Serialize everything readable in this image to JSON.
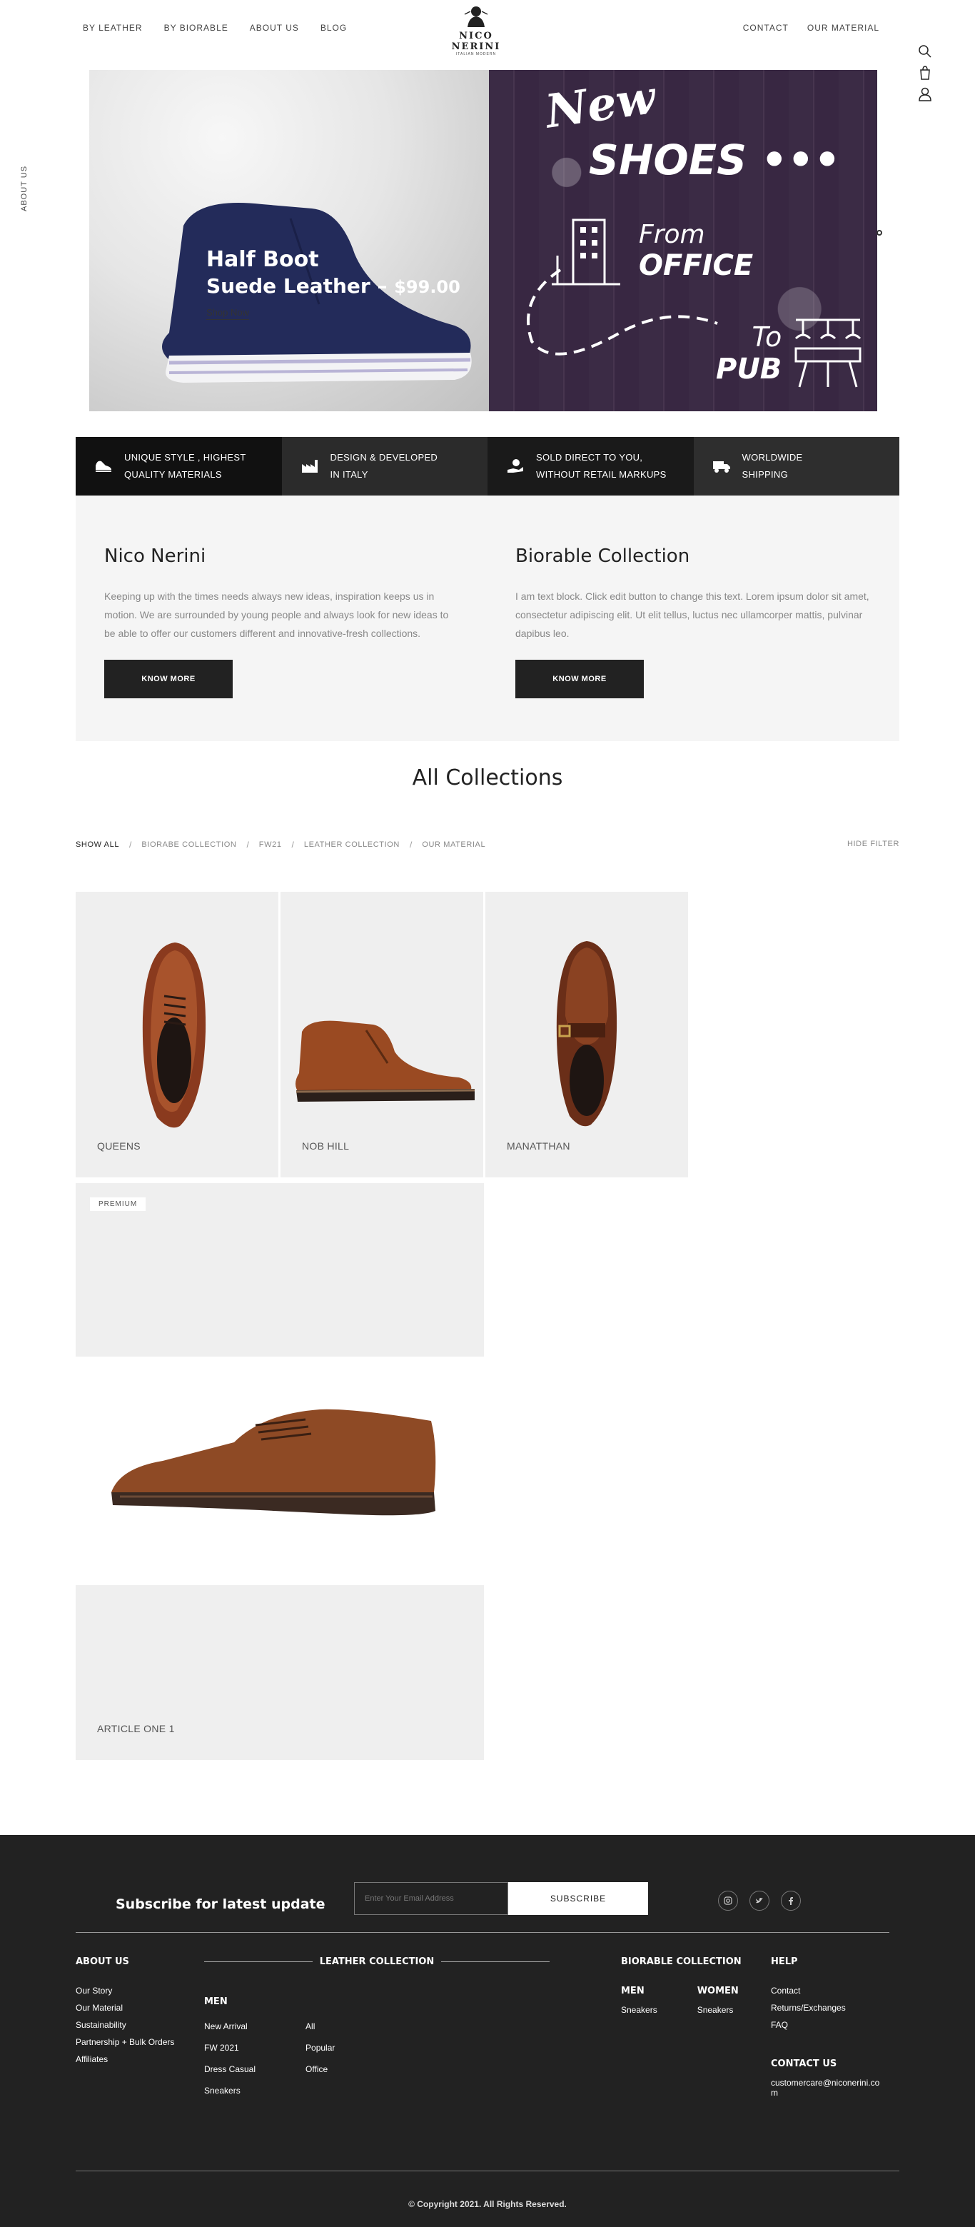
{
  "header": {
    "nav_left": [
      "BY LEATHER",
      "BY BIORABLE",
      "ABOUT US",
      "BLOG"
    ],
    "nav_right": [
      "CONTACT",
      "OUR MATERIAL"
    ],
    "logo_text": "NICO NERINI",
    "logo_sub": "ITALIAN MODERN",
    "side_label": "ABOUT US"
  },
  "hero": {
    "line1": "Half Boot",
    "line2": "Suede Leather –",
    "price": "$99.00",
    "cta": "Shop Now",
    "new": "New",
    "shoes": "SHOES •••",
    "from": "From",
    "office": "OFFICE",
    "to": "To",
    "pub": "PUB"
  },
  "features": [
    {
      "icon": "shoe-icon",
      "line1": "UNIQUE STYLE , HIGHEST",
      "line2": "QUALITY MATERIALS"
    },
    {
      "icon": "factory-icon",
      "line1": "DESIGN & DEVELOPED",
      "line2": "IN ITALY"
    },
    {
      "icon": "hand-money-icon",
      "line1": "SOLD DIRECT TO YOU,",
      "line2": "WITHOUT RETAIL MARKUPS"
    },
    {
      "icon": "truck-icon",
      "line1": "WORLDWIDE",
      "line2": "SHIPPING"
    }
  ],
  "intro": {
    "left": {
      "title": "Nico Nerini",
      "text": "Keeping up with the times needs always new ideas, inspiration keeps us in motion. We are surrounded by young people  and always look for new ideas to be able to offer our customers different and innovative-fresh collections.",
      "button": "KNOW MORE"
    },
    "right": {
      "title": "Biorable Collection",
      "text": "I am text block. Click edit button to change this text. Lorem ipsum dolor sit amet, consectetur adipiscing elit. Ut elit tellus, luctus nec ullamcorper mattis, pulvinar dapibus leo.",
      "button": "KNOW MORE"
    }
  },
  "collections": {
    "title": "All Collections",
    "filters": [
      "SHOW ALL",
      "BIORABE COLLECTION",
      "FW21",
      "LEATHER COLLECTION",
      "OUR MATERIAL"
    ],
    "hide_filter": "HIDE FILTER",
    "items": [
      {
        "label": "QUEENS"
      },
      {
        "label": "NOB HILL"
      },
      {
        "label": "MANATTHAN"
      }
    ],
    "premium_badge": "PREMIUM",
    "article_label": "ARTICLE ONE 1"
  },
  "footer": {
    "subscribe_title": "Subscribe for latest update",
    "email_placeholder": "Enter Your Email Address",
    "subscribe_button": "SUBSCRIBE",
    "about": {
      "title": "ABOUT US",
      "links": [
        "Our Story",
        "Our Material",
        "Sustainability",
        "Partnership + Bulk Orders",
        "Affiliates"
      ]
    },
    "leather": {
      "title": "LEATHER COLLECTION",
      "men_title": "MEN",
      "col1": [
        "New Arrival",
        "FW 2021",
        "Dress Casual",
        "Sneakers"
      ],
      "col2": [
        "All",
        "Popular",
        "Office"
      ]
    },
    "biorable": {
      "title": "BIORABLE COLLECTION",
      "men": "MEN",
      "women": "WOMEN",
      "men_links": [
        "Sneakers"
      ],
      "women_links": [
        "Sneakers"
      ]
    },
    "help": {
      "title": "HELP",
      "links": [
        "Contact",
        "Returns/Exchanges",
        "FAQ"
      ]
    },
    "contact": {
      "title": "CONTACT US",
      "email_line1": "customercare@niconerini.co",
      "email_line2": "m"
    },
    "copyright": "© Copyright 2021. All Rights Reserved."
  }
}
